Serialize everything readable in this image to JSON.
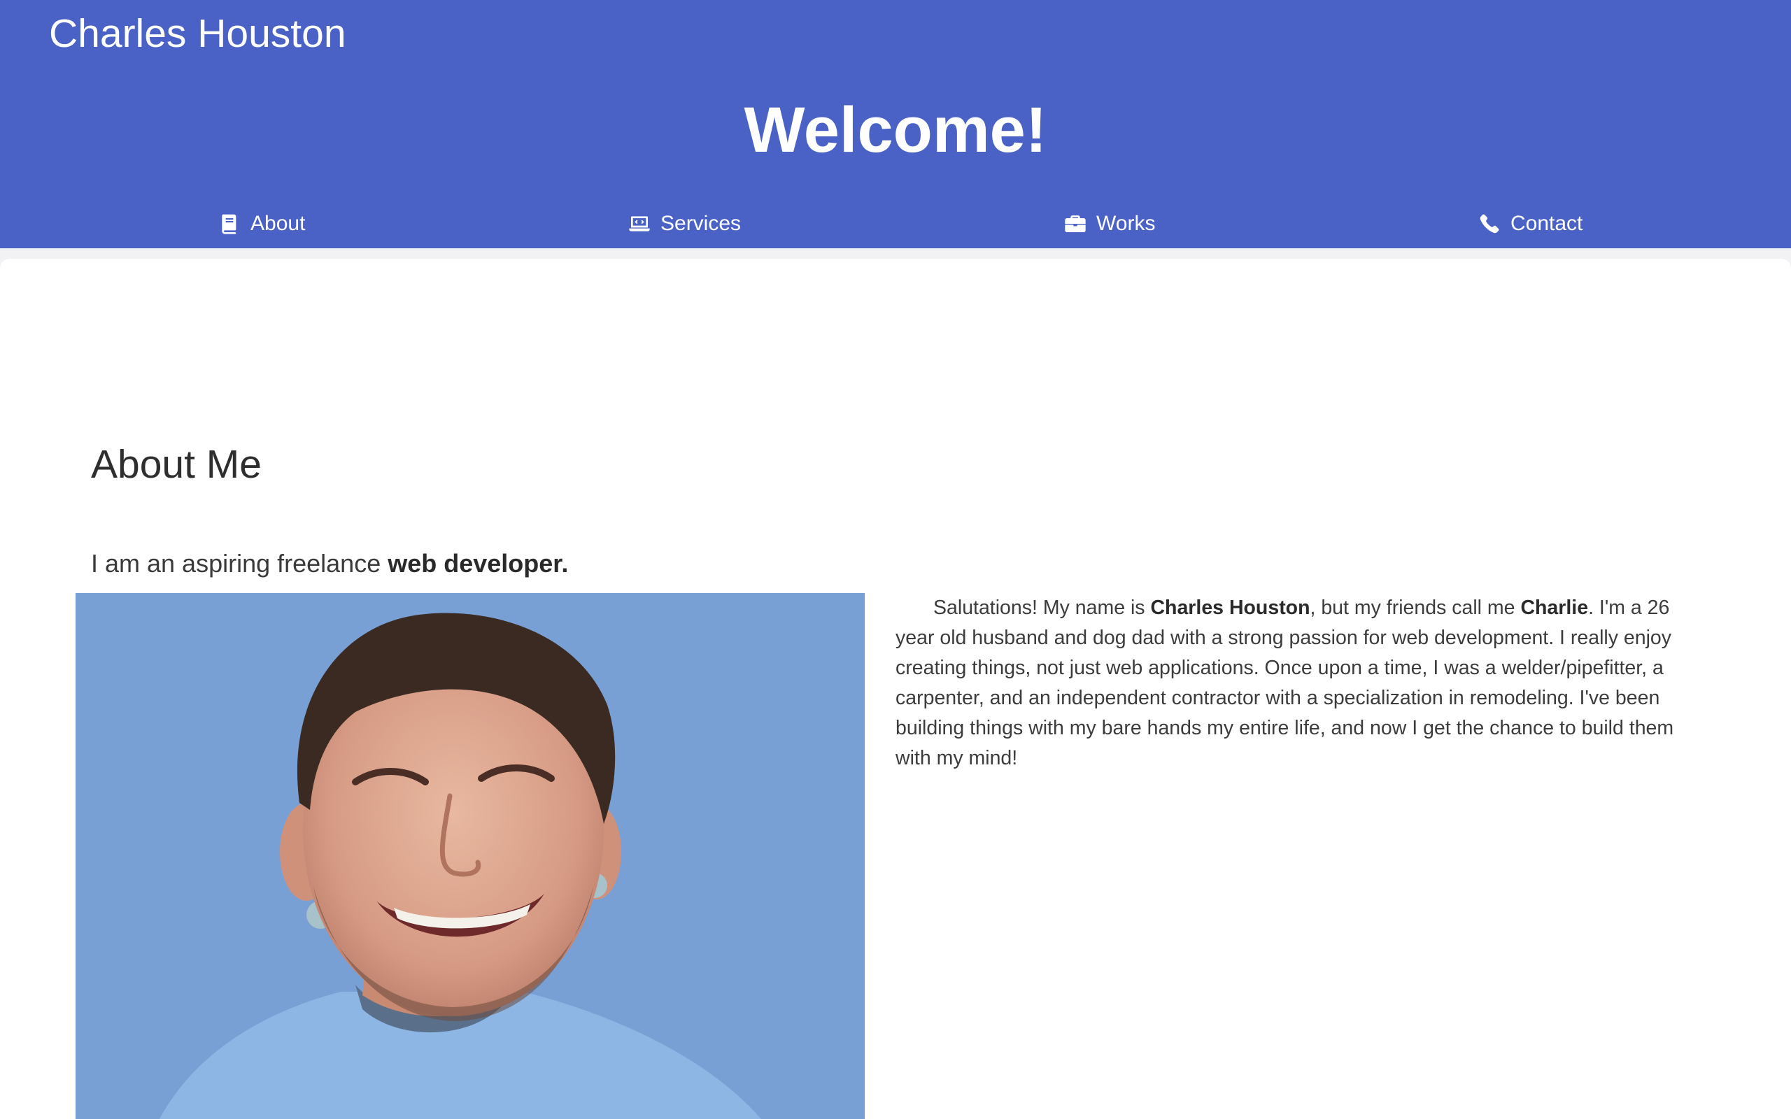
{
  "header": {
    "site_name": "Charles Houston",
    "welcome": "Welcome!"
  },
  "nav": {
    "items": [
      {
        "label": "About",
        "icon": "book-icon"
      },
      {
        "label": "Services",
        "icon": "laptop-code-icon"
      },
      {
        "label": "Works",
        "icon": "briefcase-icon"
      },
      {
        "label": "Contact",
        "icon": "phone-icon"
      }
    ]
  },
  "about": {
    "title": "About Me",
    "tagline_prefix": "I am an aspiring freelance ",
    "tagline_bold": "web developer.",
    "photo_description": "portrait-photo",
    "bio": {
      "part1": "Salutations! My name is ",
      "name_bold": "Charles Houston",
      "part2": ", but my friends call me ",
      "nickname_bold": "Charlie",
      "part3": ". I'm a 26 year old husband and dog dad with a strong passion for web development. I really enjoy creating things, not just web applications. Once upon a time, I was a welder/pipefitter, a carpenter, and an independent contractor with a specialization in remodeling. I've been building things with my bare hands my entire life, and now I get the chance to build them with my mind!"
    }
  },
  "colors": {
    "header_bg": "#4a62c5",
    "photo_bg": "#79a0d4",
    "text": "#333333"
  }
}
